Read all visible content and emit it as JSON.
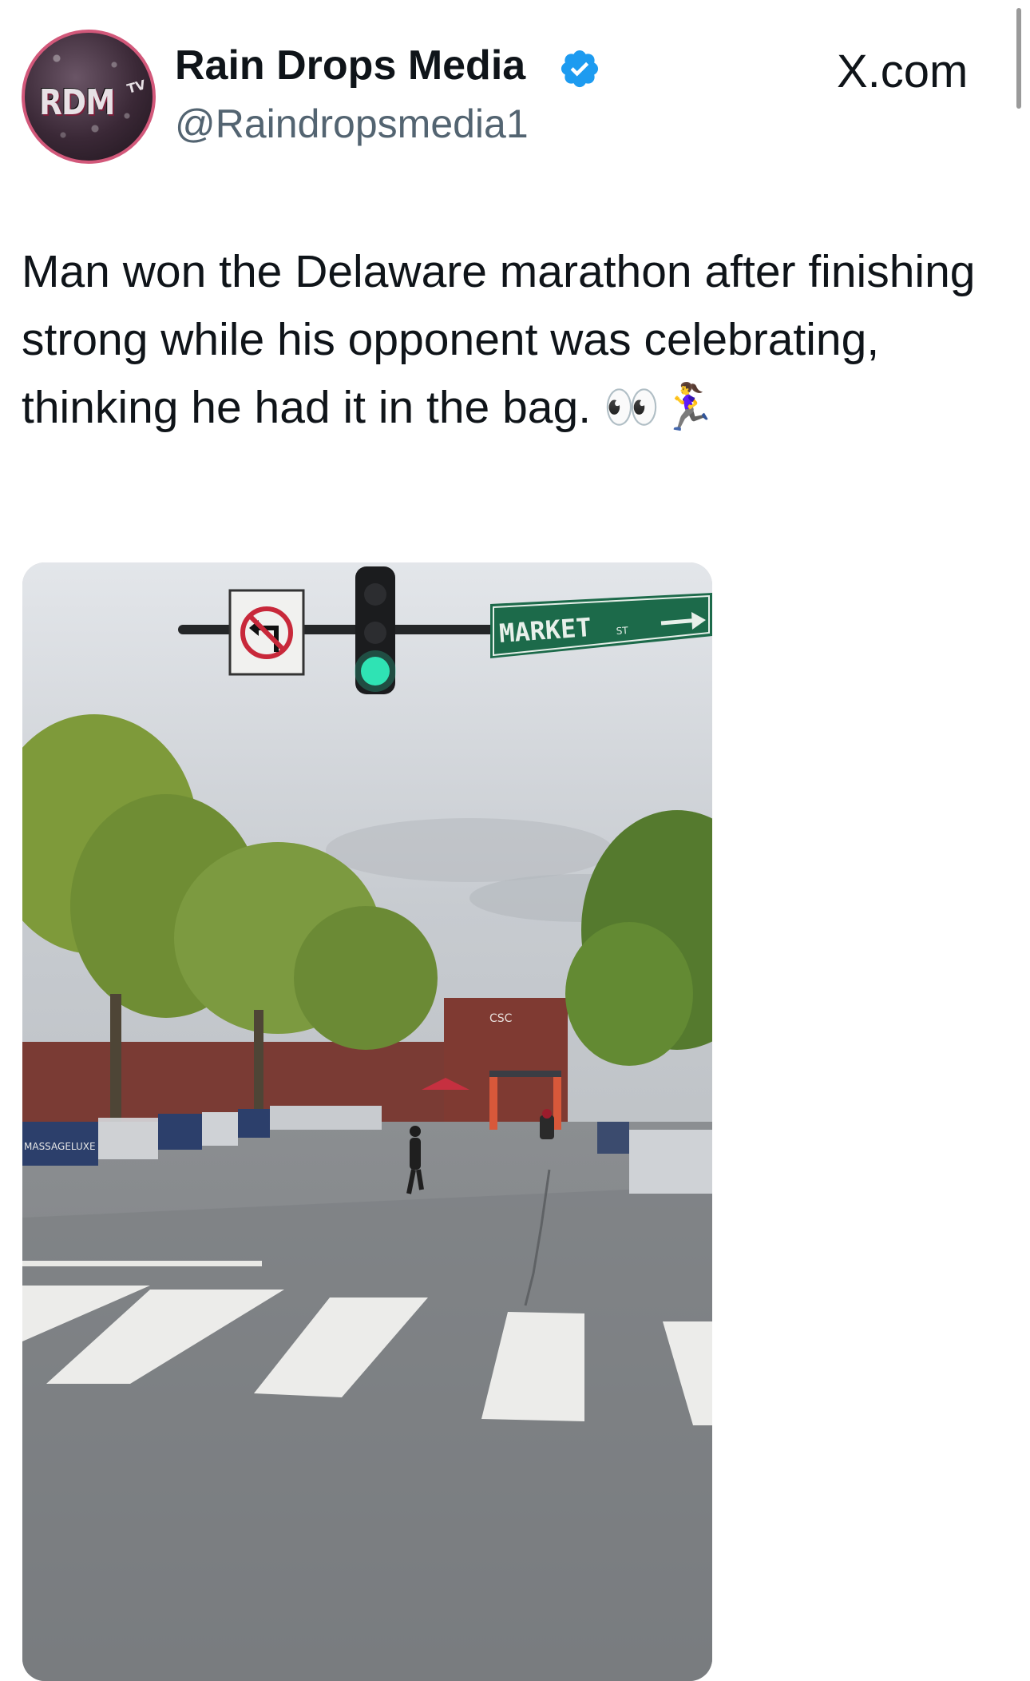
{
  "post": {
    "display_name": "Rain Drops Media",
    "handle": "@Raindropsmedia1",
    "brand": "X.com",
    "avatar_logo": "RDM",
    "avatar_logo_sup": "TV",
    "text": "Man won the Delaware marathon after finishing strong while his opponent was celebrating, thinking he had it in the bag. 👀🏃‍♀️"
  },
  "media": {
    "street_sign": "MARKET",
    "street_sign_suffix": "ST",
    "banner_left": "MASSAGELUXE",
    "building_sign": "CSC"
  },
  "icons": {
    "verified": "verified-badge-icon",
    "no_left_turn": "no-left-turn-sign-icon",
    "traffic_light": "traffic-light-icon"
  },
  "colors": {
    "verified_blue": "#1d9bf0",
    "signal_green": "#2fe3b4",
    "street_sign_green": "#1c6a4a",
    "avatar_ring": "#d2587a"
  }
}
